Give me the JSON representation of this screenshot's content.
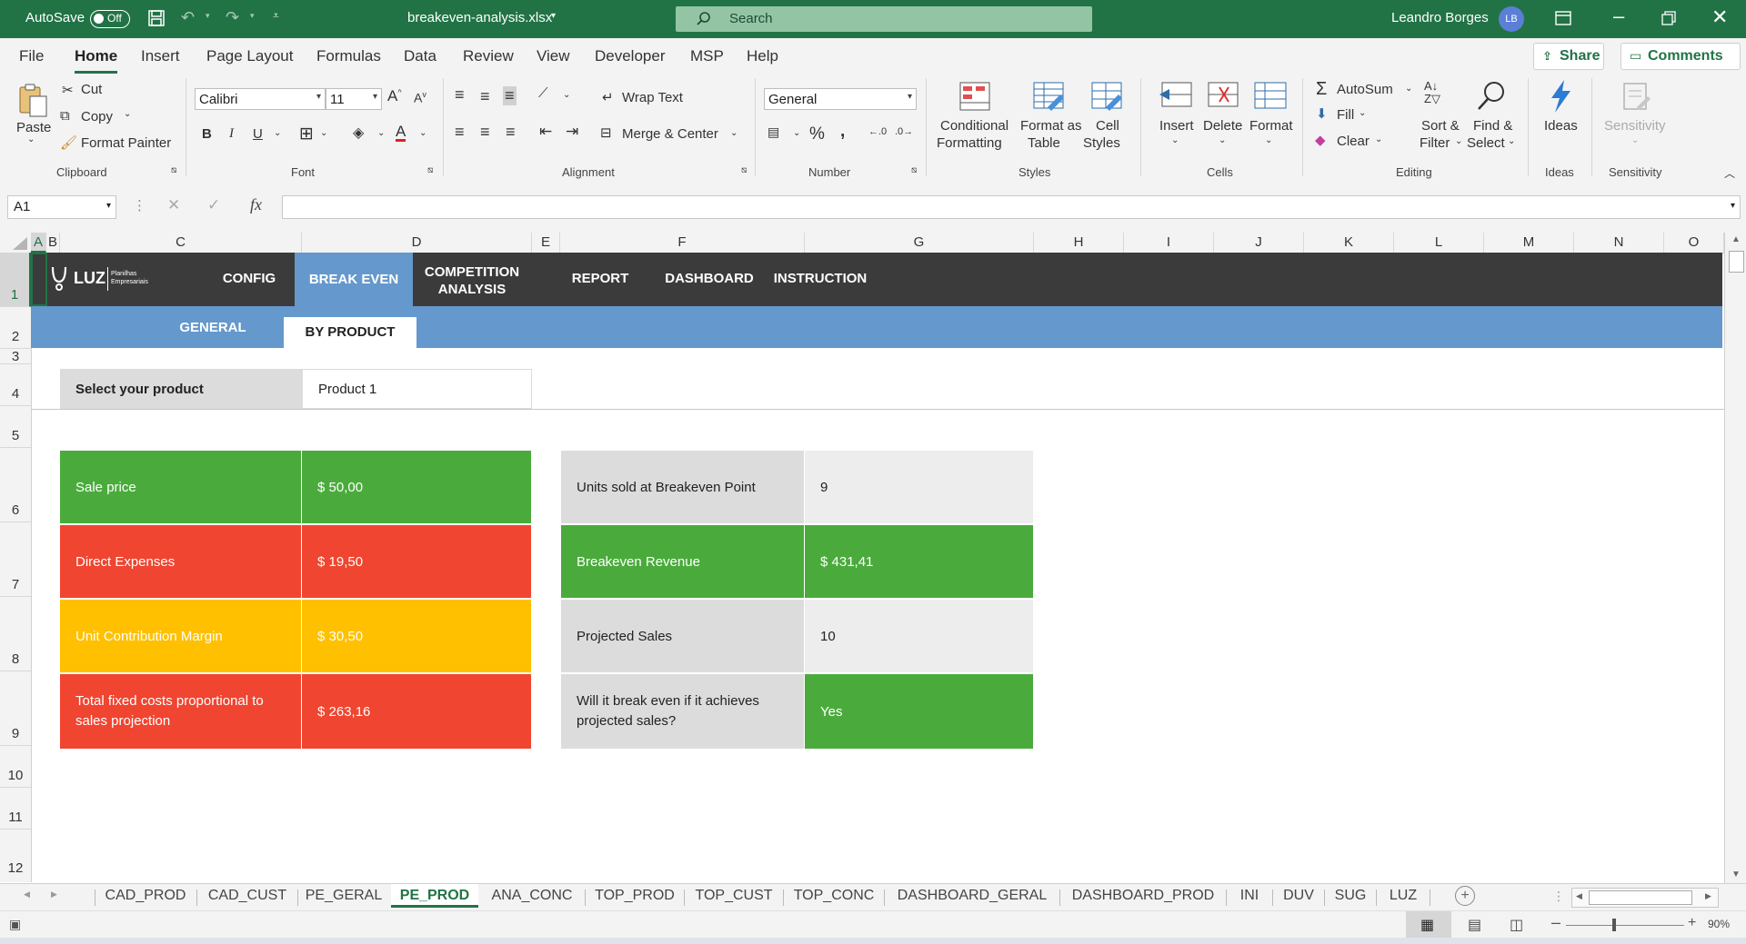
{
  "titlebar": {
    "autosave_label": "AutoSave",
    "autosave_state": "Off",
    "filename": "breakeven-analysis.xlsx",
    "search_placeholder": "Search",
    "user_name": "Leandro Borges",
    "user_initials": "LB"
  },
  "menu": {
    "tabs": [
      "File",
      "Home",
      "Insert",
      "Page Layout",
      "Formulas",
      "Data",
      "Review",
      "View",
      "Developer",
      "MSP",
      "Help"
    ],
    "active": "Home",
    "share_label": "Share",
    "comments_label": "Comments"
  },
  "ribbon": {
    "clipboard": {
      "paste": "Paste",
      "cut": "Cut",
      "copy": "Copy",
      "format_painter": "Format Painter",
      "group": "Clipboard"
    },
    "font": {
      "name": "Calibri",
      "size": "11",
      "bold": "B",
      "italic": "I",
      "underline": "U",
      "group": "Font"
    },
    "alignment": {
      "wrap_text": "Wrap Text",
      "merge_center": "Merge & Center",
      "group": "Alignment"
    },
    "number": {
      "format": "General",
      "percent": "%",
      "comma": ",",
      "group": "Number"
    },
    "styles": {
      "conditional_1": "Conditional",
      "conditional_2": "Formatting",
      "format_table_1": "Format as",
      "format_table_2": "Table",
      "cell_styles_1": "Cell",
      "cell_styles_2": "Styles",
      "group": "Styles"
    },
    "cells": {
      "insert": "Insert",
      "delete": "Delete",
      "format": "Format",
      "group": "Cells"
    },
    "editing": {
      "autosum": "AutoSum",
      "fill": "Fill",
      "clear": "Clear",
      "sort_1": "Sort &",
      "sort_2": "Filter",
      "find_1": "Find &",
      "find_2": "Select",
      "group": "Editing"
    },
    "ideas": {
      "label": "Ideas",
      "group": "Ideas"
    },
    "sensitivity": {
      "label": "Sensitivity",
      "group": "Sensitivity"
    }
  },
  "formula_bar": {
    "name_box": "A1",
    "fx": "fx",
    "formula": ""
  },
  "columns": [
    "A",
    "B",
    "C",
    "D",
    "E",
    "F",
    "G",
    "H",
    "I",
    "J",
    "K",
    "L",
    "M",
    "N",
    "O"
  ],
  "rows": [
    "1",
    "2",
    "3",
    "4",
    "5",
    "6",
    "7",
    "8",
    "9",
    "10",
    "11",
    "12"
  ],
  "sheet": {
    "logo_text": "LUZ",
    "logo_sub_1": "Planilhas",
    "logo_sub_2": "Empresariais",
    "nav": [
      "CONFIG",
      "BREAK EVEN",
      "COMPETITION ANALYSIS",
      "REPORT",
      "DASHBOARD",
      "INSTRUCTION"
    ],
    "nav_active": "BREAK EVEN",
    "subnav": [
      "GENERAL",
      "BY PRODUCT"
    ],
    "subnav_active": "BY PRODUCT",
    "select_label": "Select your product",
    "select_value": "Product 1",
    "left_table": [
      {
        "label": "Sale price",
        "value": "$ 50,00",
        "color": "#4aab3c"
      },
      {
        "label": "Direct Expenses",
        "value": "$ 19,50",
        "color": "#f04530"
      },
      {
        "label": "Unit Contribution Margin",
        "value": "$ 30,50",
        "color": "#ffc000"
      },
      {
        "label": "Total fixed costs proportional to sales projection",
        "value": "$ 263,16",
        "color": "#f04530"
      }
    ],
    "right_table": [
      {
        "label": "Units sold at Breakeven Point",
        "value": "9"
      },
      {
        "label": "Breakeven Revenue",
        "value": "$ 431,41"
      },
      {
        "label": "Projected Sales",
        "value": "10"
      },
      {
        "label": "Will it break even if it achieves projected sales?",
        "value": "Yes"
      }
    ]
  },
  "sheet_tabs": [
    "CAD_PROD",
    "CAD_CUST",
    "PE_GERAL",
    "PE_PROD",
    "ANA_CONC",
    "TOP_PROD",
    "TOP_CUST",
    "TOP_CONC",
    "DASHBOARD_GERAL",
    "DASHBOARD_PROD",
    "INI",
    "DUV",
    "SUG",
    "LUZ"
  ],
  "active_sheet": "PE_PROD",
  "status": {
    "zoom": "90%"
  }
}
